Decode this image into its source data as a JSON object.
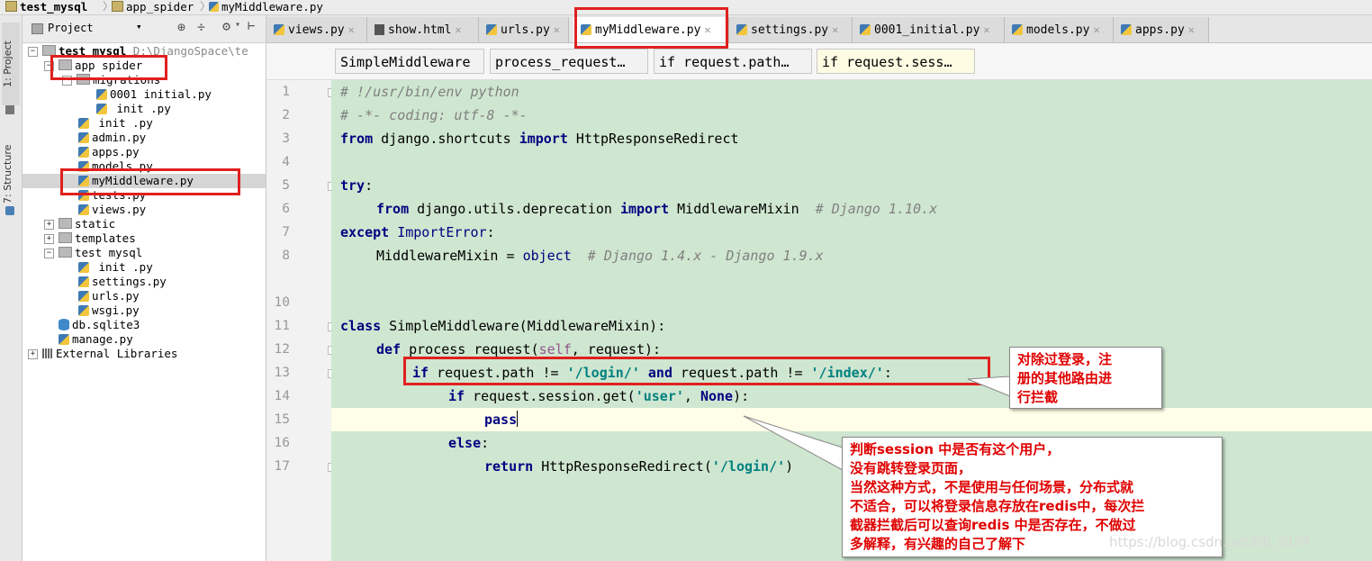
{
  "breadcrumb": [
    "test_mysql",
    "app_spider",
    "myMiddleware.py"
  ],
  "sidebar_tabs": {
    "project": "1: Project",
    "structure": "7: Structure"
  },
  "project_toolbar": {
    "label": "Project"
  },
  "tree": {
    "root_name": "test mysql",
    "root_path": "D:\\DjangoSpace\\te",
    "items": [
      {
        "label": "app spider",
        "type": "folder"
      },
      {
        "label": "migrations",
        "type": "folder"
      },
      {
        "label": "0001 initial.py",
        "type": "py"
      },
      {
        "label": "init  .py",
        "type": "py"
      },
      {
        "label": "init  .py",
        "type": "py"
      },
      {
        "label": "admin.py",
        "type": "py"
      },
      {
        "label": "apps.py",
        "type": "py"
      },
      {
        "label": "models.py",
        "type": "py"
      },
      {
        "label": "myMiddleware.py",
        "type": "py"
      },
      {
        "label": "tests.py",
        "type": "py"
      },
      {
        "label": "views.py",
        "type": "py"
      },
      {
        "label": "static",
        "type": "folder"
      },
      {
        "label": "templates",
        "type": "folder"
      },
      {
        "label": "test mysql",
        "type": "folder"
      },
      {
        "label": "init  .py",
        "type": "py"
      },
      {
        "label": "settings.py",
        "type": "py"
      },
      {
        "label": "urls.py",
        "type": "py"
      },
      {
        "label": "wsgi.py",
        "type": "py"
      },
      {
        "label": "db.sqlite3",
        "type": "db"
      },
      {
        "label": "manage.py",
        "type": "py"
      },
      {
        "label": "External Libraries",
        "type": "lib"
      }
    ]
  },
  "tabs": [
    "views.py",
    "show.html",
    "urls.py",
    "myMiddleware.py",
    "settings.py",
    "0001_initial.py",
    "models.py",
    "apps.py"
  ],
  "active_tab": "myMiddleware.py",
  "code_breadcrumbs": [
    "SimpleMiddleware",
    "process_request…",
    "if request.path…",
    "if request.sess…"
  ],
  "code": {
    "l1": "# !/usr/bin/env python",
    "l2": "# -*- coding: utf-8 -*-",
    "l3_kw1": "from",
    "l3_mod": " django.shortcuts ",
    "l3_kw2": "import",
    "l3_name": " HttpResponseRedirect",
    "l5_kw": "try",
    "l5_p": ":",
    "l6_kw1": "from",
    "l6_mod": " django.utils.deprecation ",
    "l6_kw2": "import",
    "l6_name": " MiddlewareMixin  ",
    "l6_cm": "# Django 1.10.x",
    "l7_kw": "except",
    "l7_err": " ImportError",
    "l7_p": ":",
    "l8_a": "MiddlewareMixin = ",
    "l8_obj": "object",
    "l8_cm": "  # Django 1.4.x - Django 1.9.x",
    "l11_kw": "class",
    "l11_rest": " SimpleMiddleware(MiddlewareMixin):",
    "l12_kw": "def",
    "l12_a": " process_request(",
    "l12_self": "self",
    "l12_b": ", request):",
    "l13_kw": "if",
    "l13_a": " request.path != ",
    "l13_s1": "'/login/'",
    "l13_and": " and",
    "l13_b": " request.path != ",
    "l13_s2": "'/index/'",
    "l13_p": ":",
    "l14_kw": "if",
    "l14_a": " request.session.get(",
    "l14_s": "'user'",
    "l14_b": ", ",
    "l14_none": "None",
    "l14_c": "):",
    "l15": "pass",
    "l16_kw": "else",
    "l16_p": ":",
    "l17_kw": "return",
    "l17_a": " HttpResponseRedirect(",
    "l17_s": "'/login/'",
    "l17_b": ")"
  },
  "line_numbers": [
    "1",
    "2",
    "3",
    "4",
    "5",
    "6",
    "7",
    "8",
    "10",
    "11",
    "12",
    "13",
    "14",
    "15",
    "16",
    "17"
  ],
  "callout1": [
    "对除过登录，注",
    "册的其他路由进",
    "行拦截"
  ],
  "callout2": [
    "判断session 中是否有这个用户，",
    "没有跳转登录页面，",
    "当然这种方式，不是使用与任何场景，分布式就",
    "不适合，可以将登录信息存放在redis中，每次拦",
    "截器拦截后可以查询redis 中是否存在，不做过",
    "多解释，有兴趣的自己了解下"
  ],
  "watermark": "https://blog.csdn.net/EB_NUM",
  "colors": {
    "annotation_red": "#e0201f",
    "code_bg": "#cfe6d0",
    "keyword": "#000080",
    "string": "#008080"
  }
}
